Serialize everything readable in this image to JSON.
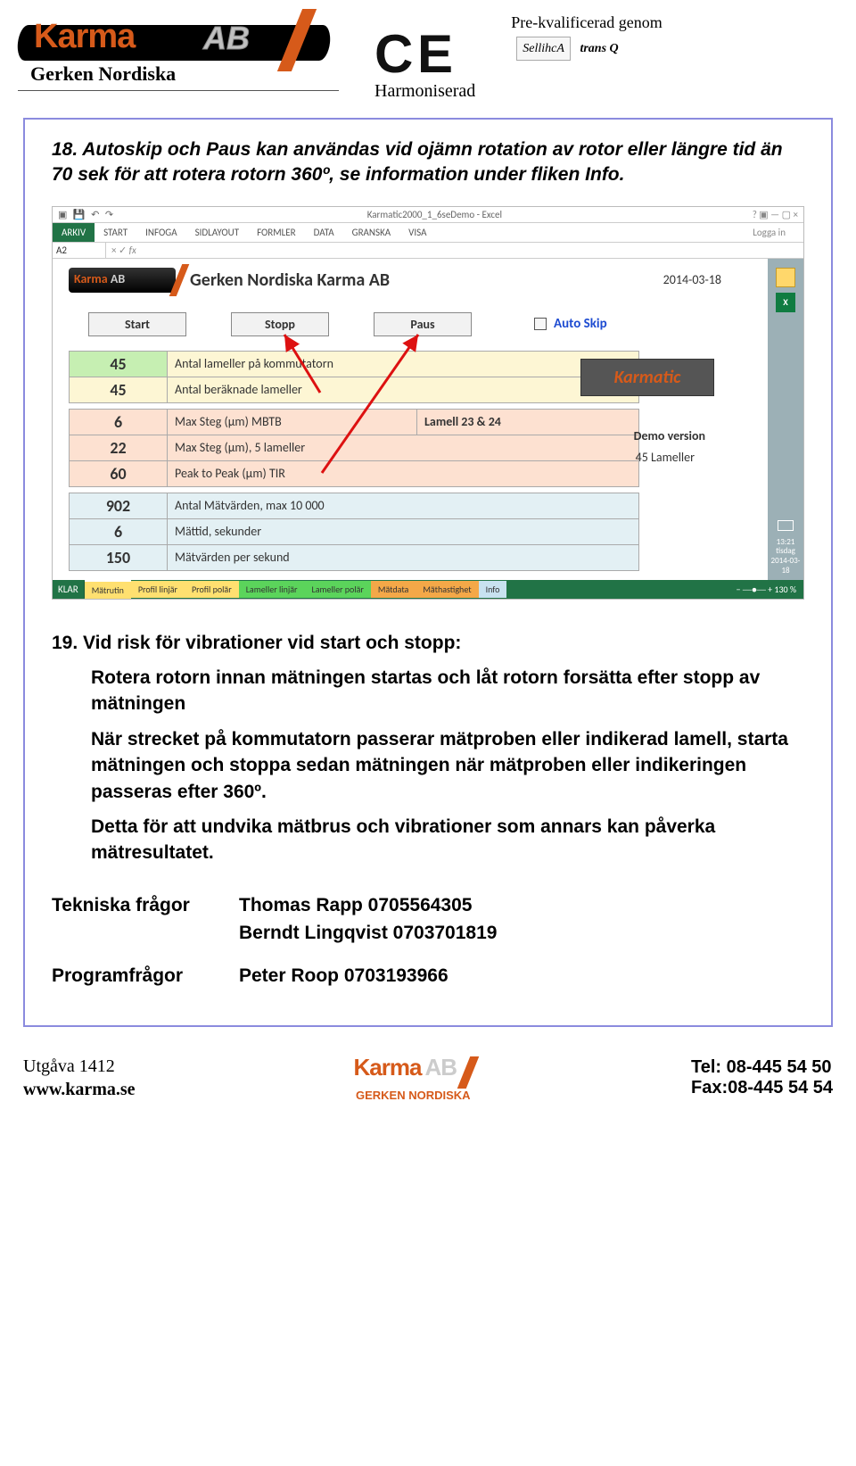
{
  "header": {
    "logo_text": "Karma",
    "logo_ab": "AB",
    "logo_sub": "Gerken Nordiska",
    "ce": "C E",
    "harmonized": "Harmoniserad",
    "prequal": "Pre-kvalificerad genom",
    "badge1": "SellihcA",
    "badge2": "trans Q"
  },
  "item18": "18. Autoskip och Paus kan användas vid ojämn rotation av rotor eller längre tid än 70 sek för att rotera rotorn 360º, se information under fliken Info.",
  "excel": {
    "title": "Karmatic2000_1_6seDemo - Excel",
    "login": "Logga in",
    "ribbon": {
      "file": "ARKIV",
      "tabs": [
        "START",
        "INFOGA",
        "SIDLAYOUT",
        "FORMLER",
        "DATA",
        "GRANSKA",
        "VISA"
      ]
    },
    "cellref": "A2",
    "company": "Gerken Nordiska Karma AB",
    "date": "2014-03-18",
    "buttons": {
      "start": "Start",
      "stop": "Stopp",
      "pause": "Paus",
      "autoskip": "Auto Skip"
    },
    "rows": {
      "r1": {
        "val": "45",
        "label": "Antal lameller på kommutatorn"
      },
      "r2": {
        "val": "45",
        "label": "Antal beräknade lameller"
      },
      "r3": {
        "val": "6",
        "label": "Max Steg  (µm)   MBTB",
        "extra": "Lamell 23 & 24"
      },
      "r4": {
        "val": "22",
        "label": "Max Steg  (µm), 5 lameller"
      },
      "r5": {
        "val": "60",
        "label": "Peak to Peak  (µm)   TIR"
      },
      "r6": {
        "val": "902",
        "label": "Antal Mätvärden, max 10 000"
      },
      "r7": {
        "val": "6",
        "label": "Mättid, sekunder"
      },
      "r8": {
        "val": "150",
        "label": "Mätvärden per sekund"
      }
    },
    "badge": "Karmatic",
    "demo": "Demo version",
    "lam": "45  Lameller",
    "tabs": [
      "Mätrutin",
      "Profil linjär",
      "Profil polär",
      "Lameller linjär",
      "Lameller polär",
      "Mätdata",
      "Mäthastighet",
      "Info"
    ],
    "statusbar": "KLAR",
    "zoom": "130 %",
    "clock": {
      "time": "13:21",
      "day": "tisdag",
      "date": "2014-03-18"
    }
  },
  "item19": {
    "title": "19. Vid risk för vibrationer vid start och stopp:",
    "p1": "Rotera rotorn innan mätningen startas och låt rotorn forsätta efter stopp av mätningen",
    "p2": "När strecket på kommutatorn passerar mätproben eller indikerad lamell, starta mätningen och stoppa sedan mätningen när mätproben eller indikeringen passeras efter 360º.",
    "p3": "Detta för att undvika mätbrus och vibrationer som annars kan påverka mätresultatet."
  },
  "contacts": {
    "tech_lbl": "Tekniska frågor",
    "tech1": "Thomas Rapp 0705564305",
    "tech2": "Berndt Lingqvist 0703701819",
    "prog_lbl": "Programfrågor",
    "prog1": "Peter Roop 0703193966"
  },
  "footer": {
    "edition": "Utgåva 1412",
    "url": "www.karma.se",
    "brand": "Karma",
    "brand_ab": "AB",
    "brand_sub": "GERKEN NORDISKA",
    "tel": "Tel: 08-445 54 50",
    "fax": "Fax:08-445 54 54"
  }
}
